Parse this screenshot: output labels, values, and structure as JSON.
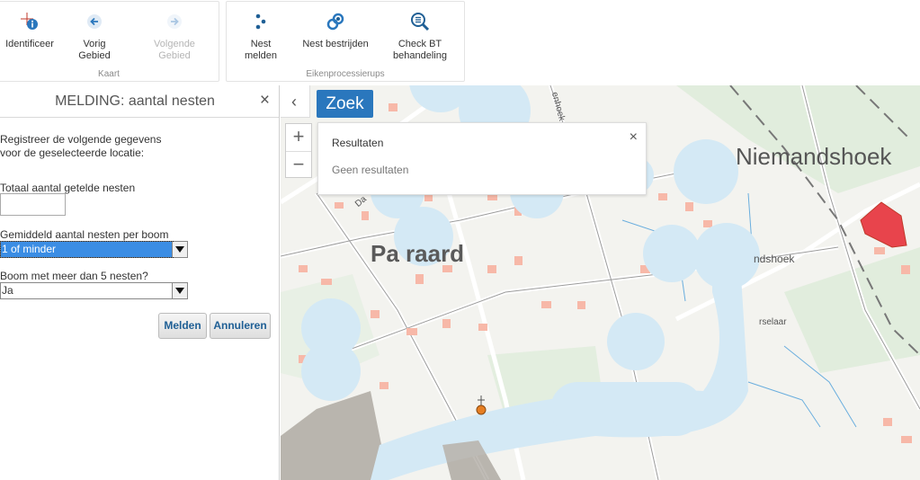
{
  "ribbon": {
    "groups": [
      {
        "label": "Kaart",
        "buttons": [
          {
            "label": "Identificeer",
            "icon": "identify-icon",
            "enabled": true
          },
          {
            "label": "Vorig Gebied",
            "icon": "back-arrow-icon",
            "enabled": true
          },
          {
            "label": "Volgende Gebied",
            "icon": "forward-arrow-icon",
            "enabled": false
          }
        ]
      },
      {
        "label": "Eikenprocessierups",
        "buttons": [
          {
            "label": "Nest melden",
            "icon": "nest-dots-icon",
            "enabled": true
          },
          {
            "label": "Nest bestrijden",
            "icon": "nest-fight-icon",
            "enabled": true
          },
          {
            "label": "Check BT behandeling",
            "icon": "magnifier-list-icon",
            "enabled": true
          }
        ]
      }
    ]
  },
  "panel": {
    "title": "MELDING: aantal nesten",
    "close": "×",
    "intro": "Registreer de volgende gegevens voor de geselecteerde locatie:",
    "total_label": "Totaal aantal getelde nesten",
    "total_value": "",
    "avg_label": "Gemiddeld aantal nesten per boom",
    "avg_value": "1 of minder",
    "boom_label": "Boom met meer dan 5 nesten?",
    "boom_value": "Ja",
    "submit": "Melden",
    "cancel": "Annuleren"
  },
  "map": {
    "collapse": "‹",
    "search_button": "Zoek",
    "zoom_in": "+",
    "zoom_out": "−",
    "results": {
      "title": "Resultaten",
      "message": "Geen resultaten",
      "close": "×"
    },
    "labels": {
      "niemandshoek": "Niemandshoek",
      "paardraard": "Pa    raard",
      "ndshoek": "ndshoek",
      "rselaar": "rselaar",
      "enhoek": "enhoek",
      "da": "Da"
    },
    "colors": {
      "water": "#d4e9f5",
      "building": "#f7b8a8",
      "parcel_highlight": "#e8444c",
      "marker": "#e67e22"
    }
  }
}
